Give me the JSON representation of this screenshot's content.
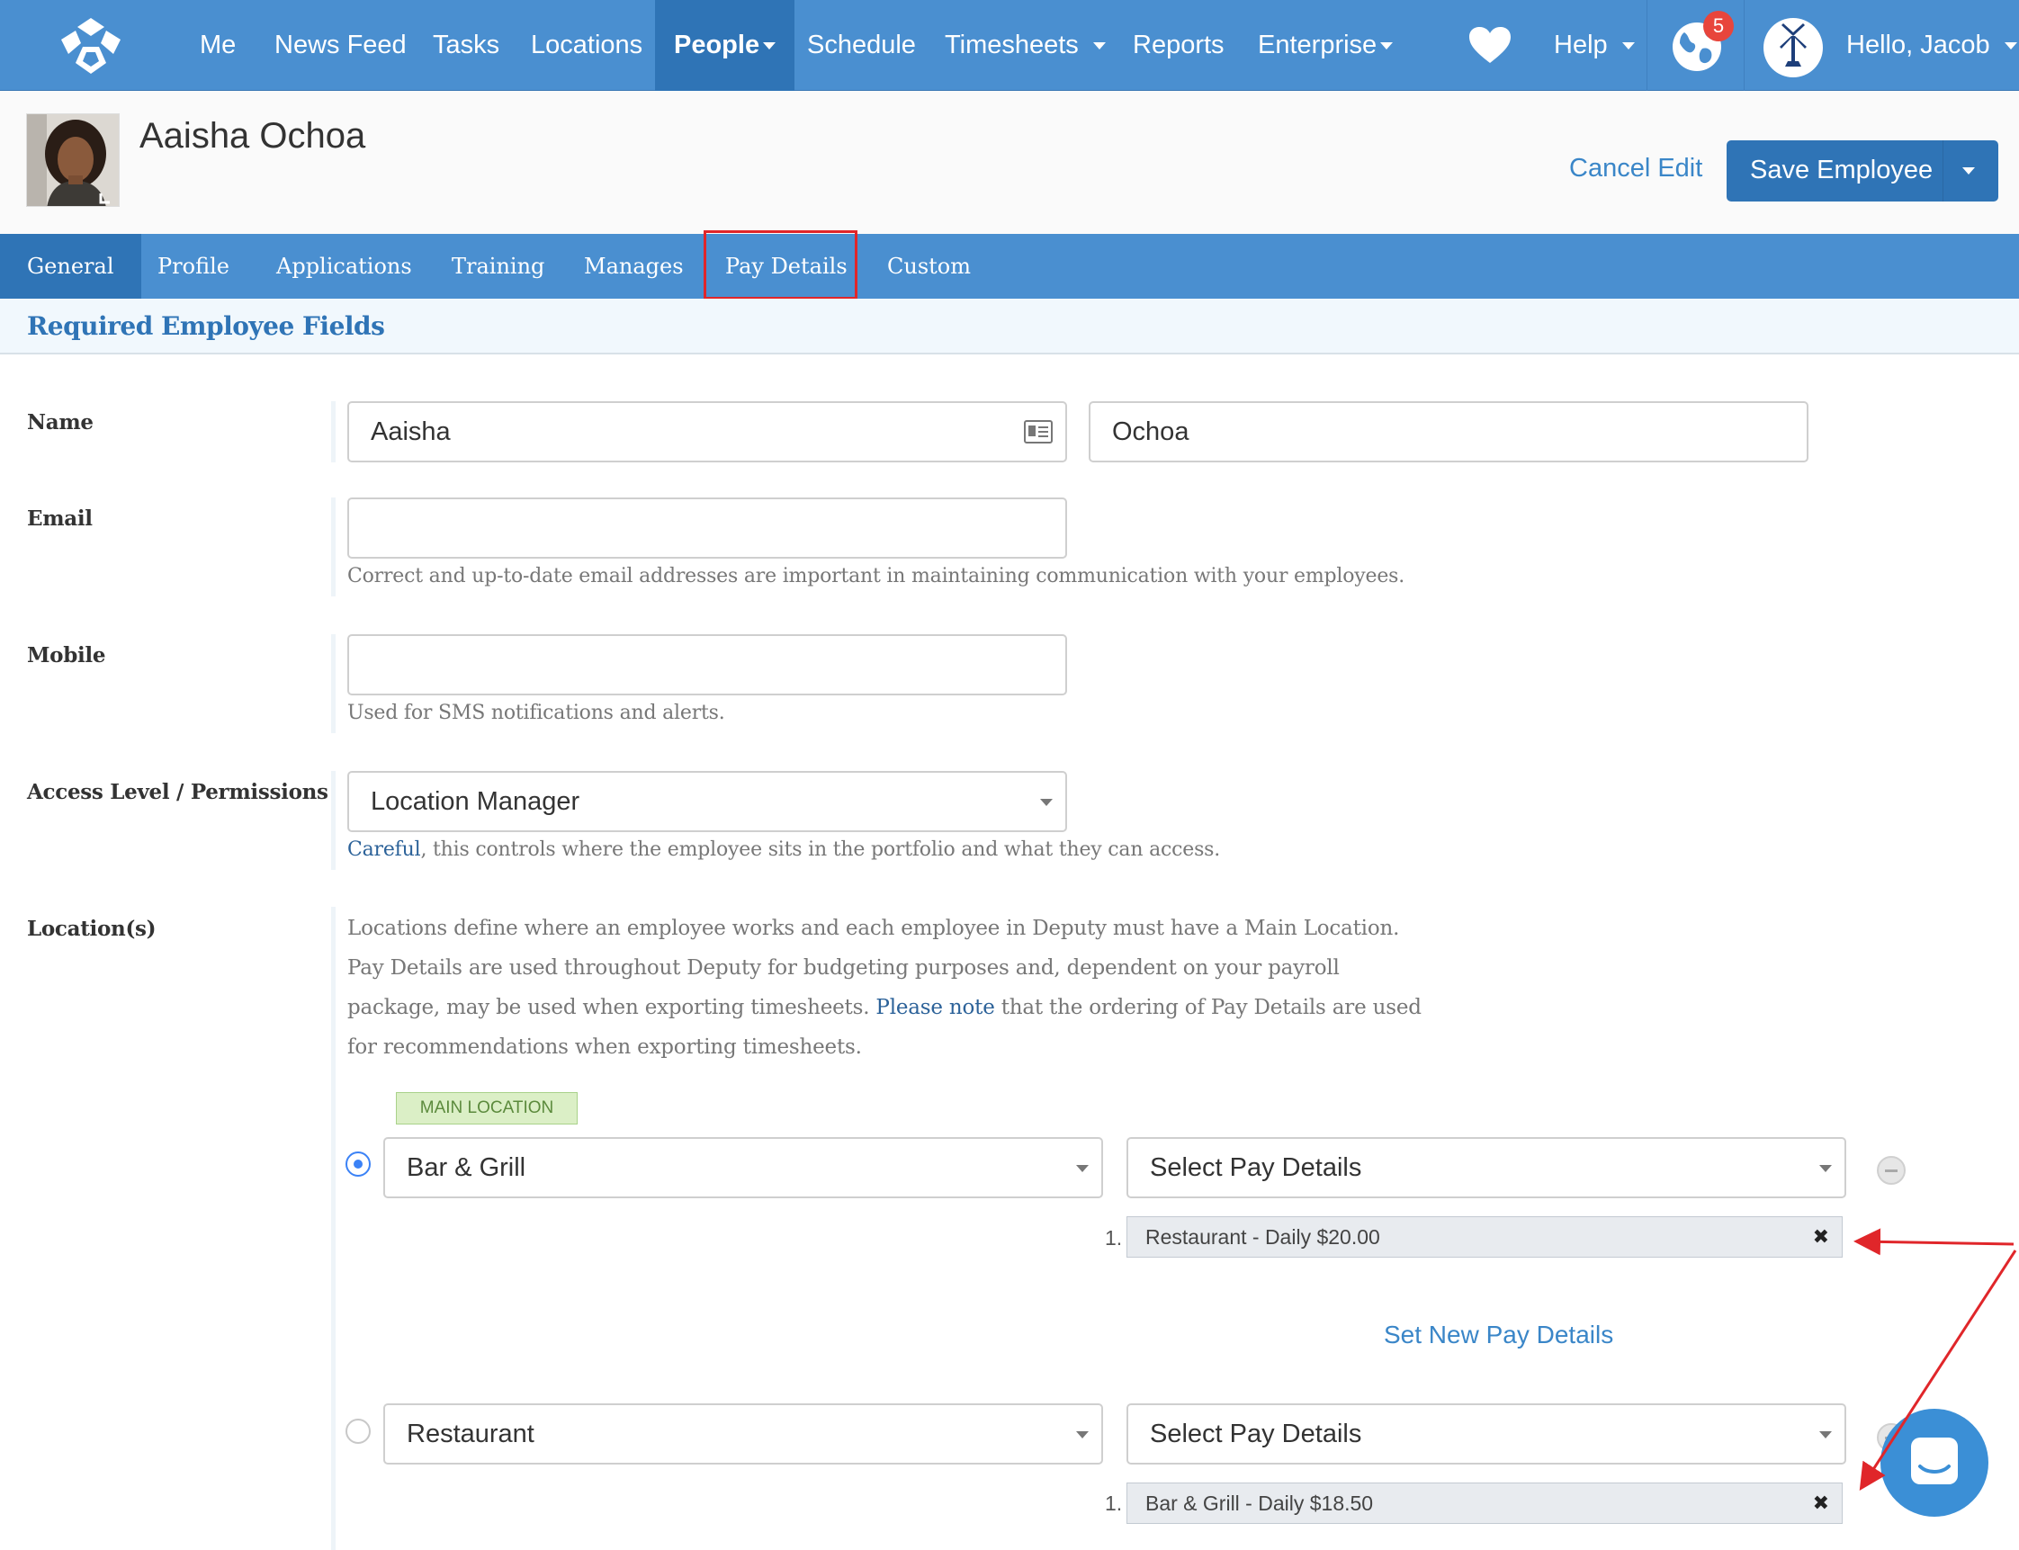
{
  "nav": {
    "items": [
      "Me",
      "News Feed",
      "Tasks",
      "Locations",
      "People",
      "Schedule",
      "Timesheets",
      "Reports",
      "Enterprise",
      "Help"
    ],
    "notifications_count": "5",
    "greeting": "Hello, Jacob",
    "icons": [
      "deputy-logo-icon",
      "heart-icon",
      "globe-icon",
      "company-avatar-icon",
      "chevron-down-icon"
    ]
  },
  "header": {
    "employee_name": "Aaisha Ochoa",
    "cancel_label": "Cancel Edit",
    "save_label": "Save Employee"
  },
  "tabs": [
    "General",
    "Profile",
    "Applications",
    "Training",
    "Manages",
    "Pay Details",
    "Custom"
  ],
  "section_title": "Required Employee Fields",
  "fields": {
    "name_label": "Name",
    "first_name": "Aaisha",
    "last_name": "Ochoa",
    "email_label": "Email",
    "email_value": "",
    "email_help": "Correct and up-to-date email addresses are important in maintaining communication with your employees.",
    "mobile_label": "Mobile",
    "mobile_value": "",
    "mobile_help": "Used for SMS notifications and alerts.",
    "access_label": "Access Level / Permissions",
    "access_value": "Location Manager",
    "access_help_strong": "Careful",
    "access_help_rest": ", this controls where the employee sits in the portfolio and what they can access.",
    "locations_label": "Location(s)",
    "locations_help_1": "Locations define where an employee works and each employee in Deputy must have a Main Location. Pay Details are used throughout Deputy for budgeting purposes and, dependent on your payroll package, may be used when exporting timesheets. ",
    "locations_help_note": "Please note",
    "locations_help_2": " that the ordering of Pay Details are used for recommendations when exporting timesheets."
  },
  "locations": {
    "main_tag": "MAIN LOCATION",
    "rows": [
      {
        "location": "Bar & Grill",
        "pay_select": "Select Pay Details",
        "pay_num": "1.",
        "pay_item": "Restaurant - Daily $20.00",
        "main": true
      },
      {
        "location": "Restaurant",
        "pay_select": "Select Pay Details",
        "pay_num": "1.",
        "pay_item": "Bar & Grill - Daily $18.50",
        "main": false
      }
    ],
    "set_new_label": "Set New Pay Details"
  },
  "colors": {
    "nav_bg": "#4a8fd0",
    "nav_active": "#2f74b6",
    "link": "#3a86c8",
    "annotation_red": "#e0262a"
  }
}
